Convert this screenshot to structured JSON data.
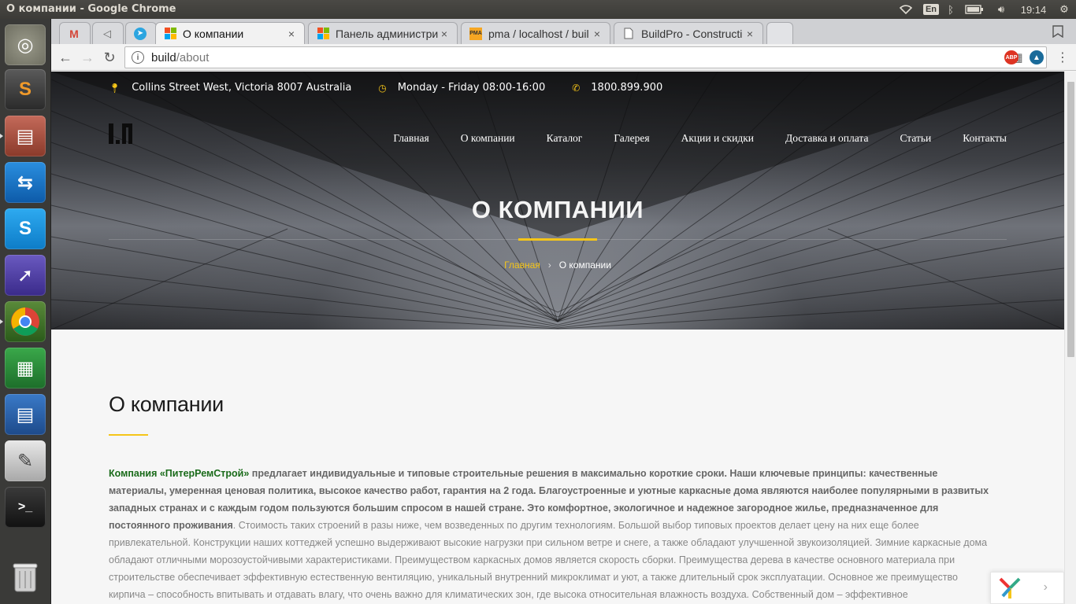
{
  "os": {
    "window_title": "О компании - Google Chrome",
    "keyboard_layout": "En",
    "clock": "19:14"
  },
  "launcher": {
    "apps": [
      {
        "name": "ubuntu-dash",
        "color": "#c05a1a",
        "glyph": "◎"
      },
      {
        "name": "sublime-text",
        "color": "#4a4a4a",
        "glyph": "S"
      },
      {
        "name": "files",
        "color": "#b55a4a",
        "glyph": "▤"
      },
      {
        "name": "teamviewer",
        "color": "#1a74c9",
        "glyph": "⇆"
      },
      {
        "name": "skype",
        "color": "#1d9be0",
        "glyph": "S"
      },
      {
        "name": "screenshot-tool",
        "color": "#4a3d9a",
        "glyph": "➚"
      },
      {
        "name": "chrome",
        "color": "#3c7a3c",
        "glyph": "◉"
      },
      {
        "name": "calc-spreadsheet",
        "color": "#2e8b3a",
        "glyph": "▦"
      },
      {
        "name": "writer-document",
        "color": "#2b64a8",
        "glyph": "▤"
      },
      {
        "name": "text-editor",
        "color": "#7a7a7a",
        "glyph": "✎"
      },
      {
        "name": "terminal",
        "color": "#2b2b2b",
        "glyph": ">_"
      },
      {
        "name": "trash",
        "color": "#555",
        "glyph": "🗑"
      }
    ]
  },
  "browser": {
    "tabs": [
      {
        "title": "",
        "icon": "gmail-icon"
      },
      {
        "title": "",
        "icon": "audio-icon"
      },
      {
        "title": "",
        "icon": "telegram-icon"
      },
      {
        "title": "О компании",
        "icon": "windows-logo-icon",
        "close": "×"
      },
      {
        "title": "Панель администрир",
        "icon": "windows-logo-icon",
        "close": "×"
      },
      {
        "title": "pma / localhost / buil",
        "icon": "phpmyadmin-icon",
        "close": "×"
      },
      {
        "title": "BuildPro - Constructi",
        "icon": "document-icon",
        "close": "×"
      }
    ],
    "address_host": "build",
    "address_path": "/about"
  },
  "site": {
    "info": {
      "address": "Collins Street West, Victoria 8007 Australia",
      "hours": "Monday - Friday 08:00-16:00",
      "phone": "1800.899.900"
    },
    "menu": [
      "Главная",
      "О компании",
      "Каталог",
      "Галерея",
      "Акции и скидки",
      "Доставка и оплата",
      "Статьи",
      "Контакты"
    ],
    "hero_title": "О КОМПАНИИ",
    "breadcrumb": {
      "home": "Главная",
      "sep": "›",
      "current": "О компании"
    },
    "content": {
      "heading": "О компании",
      "brand": "Компания «ПитерРемСтрой»",
      "bold_text": " предлагает индивидуальные и типовые строительные решения в максимально короткие сроки. Наши ключевые принципы: качественные материалы, умеренная ценовая политика, высокое качество работ, гарантия на 2 года. Благоустроенные и уютные каркасные дома являются наиболее популярными в развитых западных странах и с каждым годом пользуются большим спросом в нашей стране. Это комфортное, экологичное и надежное загородное жилье, предназначенное для постоянного проживания",
      "body_text": ". Стоимость таких строений в разы ниже, чем возведенных по другим технологиям. Большой выбор типовых проектов делает цену на них еще более привлекательной. Конструкции наших коттеджей успешно выдерживают высокие нагрузки при сильном ветре и снеге, а также обладают улучшенной звукоизоляцией. Зимние каркасные дома обладают отличными морозоустойчивыми характеристиками. Преимуществом каркасных домов является скорость сборки. Преимущества дерева в качестве основного материала при строительстве обеспечивает эффективную естественную вентиляцию, уникальный внутренний микроклимат и уют, а также длительный срок эксплуатации. Основное же преимущество кирпича – способность впитывать и отдавать влагу, что очень важно для климатических зон, где высока относительная влажность воздуха. Собственный дом – эффективное"
    },
    "accent_color": "#f5c518"
  }
}
